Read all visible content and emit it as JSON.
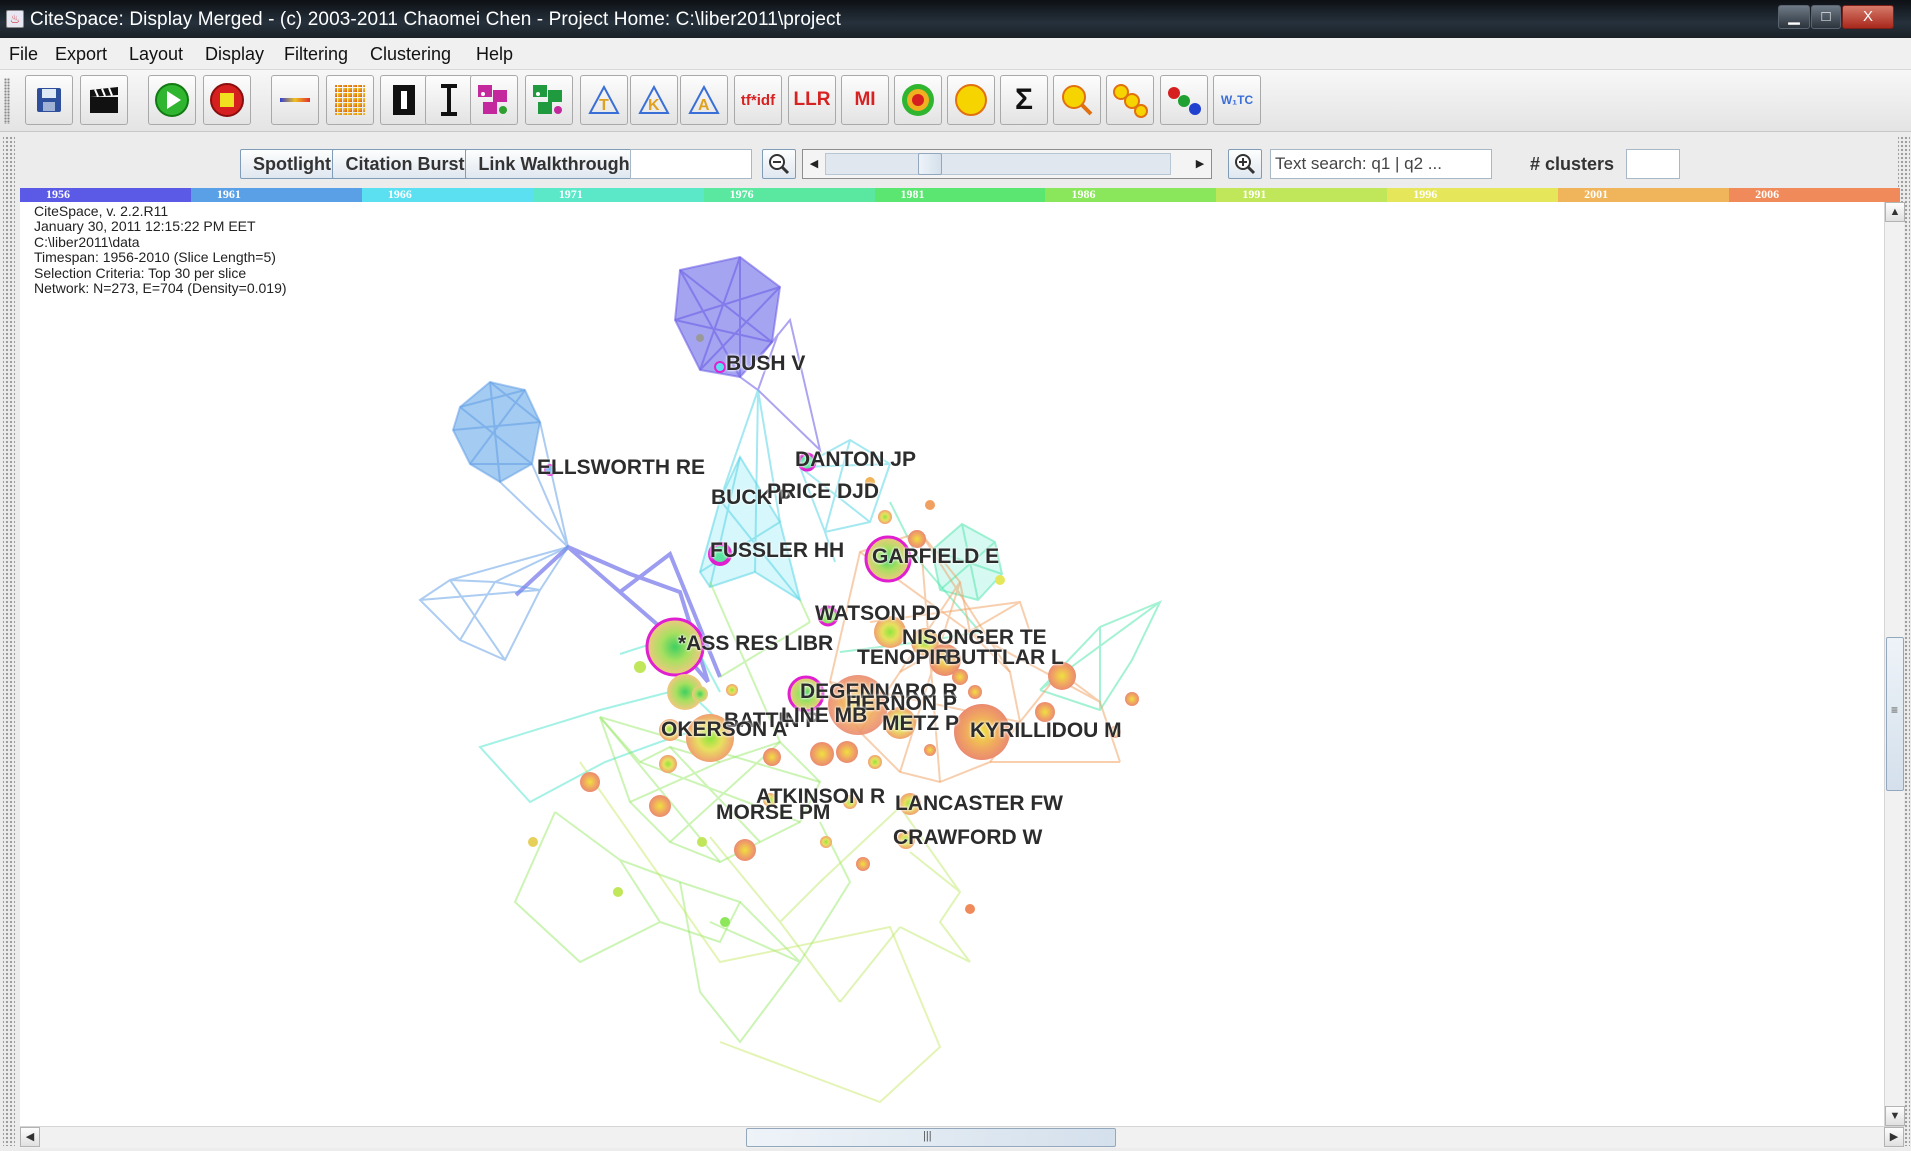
{
  "window": {
    "title": "CiteSpace: Display Merged - (c) 2003-2011 Chaomei Chen - Project Home: C:\\liber2011\\project",
    "minimize": "▁",
    "maximize": "□",
    "close": "X"
  },
  "menu": [
    "File",
    "Export",
    "Layout",
    "Display",
    "Filtering",
    "Clustering",
    "Help"
  ],
  "toolbar": {
    "tfidf": "tf*idf",
    "llr": "LLR",
    "mi": "MI",
    "sigma": "Σ",
    "wc": "W₁TC"
  },
  "controls": {
    "spotlight": "Spotlight",
    "citation_burst": "Citation Burst",
    "link_walkthrough": "Link Walkthrough",
    "search_value": "Text search: q1 | q2 ...",
    "clusters_label": "# clusters"
  },
  "timeline": {
    "years": [
      "1956",
      "1961",
      "1966",
      "1971",
      "1976",
      "1981",
      "1986",
      "1991",
      "1996",
      "2001",
      "2006"
    ],
    "colors": [
      "#5a5ae6",
      "#5aa0e6",
      "#5ae0f0",
      "#5ae8c8",
      "#5ae8a0",
      "#5ae670",
      "#8ae65a",
      "#c0e65a",
      "#e6e65a",
      "#f0b45a",
      "#f08a5a"
    ]
  },
  "info": {
    "version": "CiteSpace, v. 2.2.R11",
    "date": "January 30, 2011 12:15:22 PM EET",
    "path": "C:\\liber2011\\data",
    "timespan": "Timespan: 1956-2010 (Slice Length=5)",
    "criteria": "Selection Criteria: Top 30 per slice",
    "network": "Network: N=273, E=704 (Density=0.019)"
  },
  "labels": {
    "bush": "BUSH V",
    "ellsworth": "ELLSWORTH RE",
    "danton": "DANTON JP",
    "buck": "BUCK P",
    "price": "PRICE DJD",
    "fussler": "FUSSLER HH",
    "garfield": "GARFIELD E",
    "watson": "WATSON PD",
    "ass": "*ASS RES LIBR",
    "nisonger": "NISONGER TE",
    "tenopir": "TENOPIR",
    "buttlar": "BUTTLAR L",
    "degennaro": "DEGENNARO R",
    "hernon": "HERNON P",
    "line": "LINE MB",
    "battin": "BATTIN P",
    "okerson": "OKERSON A",
    "metz": "METZ P",
    "kyrillidou": "KYRILLIDOU M",
    "atkinson": "ATKINSON R",
    "morse": "MORSE PM",
    "lancaster": "LANCASTER FW",
    "crawford": "CRAWFORD W"
  },
  "scrollbars": {
    "grip": "≡",
    "hgrip": "|||"
  }
}
